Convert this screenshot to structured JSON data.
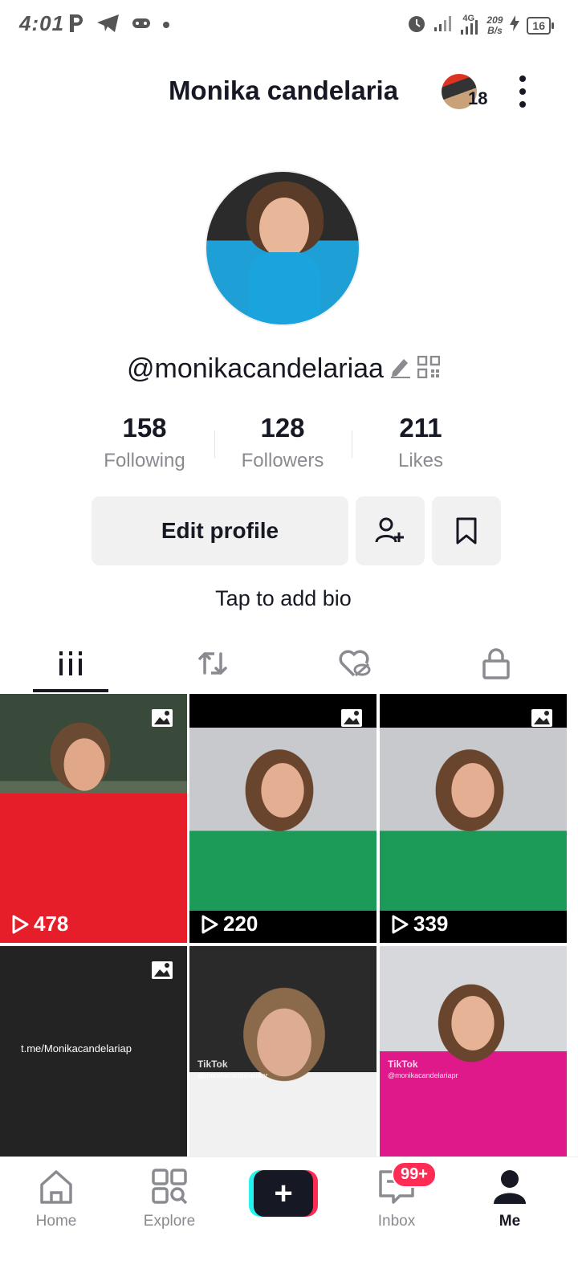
{
  "status_bar": {
    "time": "4:01",
    "network": "4G",
    "speed_value": "209",
    "speed_unit": "B/s",
    "battery": "16",
    "icons": [
      "parking-icon",
      "telegram-icon",
      "gamepad-icon",
      "dot-icon",
      "alarm-icon",
      "signal-icon",
      "signal-4g-icon",
      "charging-icon",
      "battery-icon"
    ]
  },
  "header": {
    "title": "Monika candelaria",
    "friends_count": "18"
  },
  "profile": {
    "username": "@monikacandelariaa",
    "stats": [
      {
        "value": "158",
        "label": "Following"
      },
      {
        "value": "128",
        "label": "Followers"
      },
      {
        "value": "211",
        "label": "Likes"
      }
    ],
    "edit_label": "Edit profile",
    "bio_placeholder": "Tap to add bio"
  },
  "tabs": [
    "videos-grid-icon",
    "reposts-icon",
    "liked-hidden-icon",
    "private-lock-icon"
  ],
  "videos": [
    {
      "views": "478",
      "has_photo_icon": true
    },
    {
      "views": "220",
      "has_photo_icon": true
    },
    {
      "views": "339",
      "has_photo_icon": true
    },
    {
      "caption": "t.me/Monikacandelariap",
      "has_photo_icon": true
    },
    {
      "watermark": "TikTok",
      "handle": "@monikacandelariapr"
    },
    {
      "watermark": "TikTok",
      "handle": "@monikacandelariapr"
    }
  ],
  "bottom_nav": {
    "home": "Home",
    "explore": "Explore",
    "inbox": "Inbox",
    "inbox_badge": "99+",
    "me": "Me"
  },
  "colors": {
    "text": "#161823",
    "muted": "#8a8b91",
    "accent_pink": "#fe2c55",
    "accent_cyan": "#25f4ee",
    "button_bg": "#f1f1f2"
  }
}
